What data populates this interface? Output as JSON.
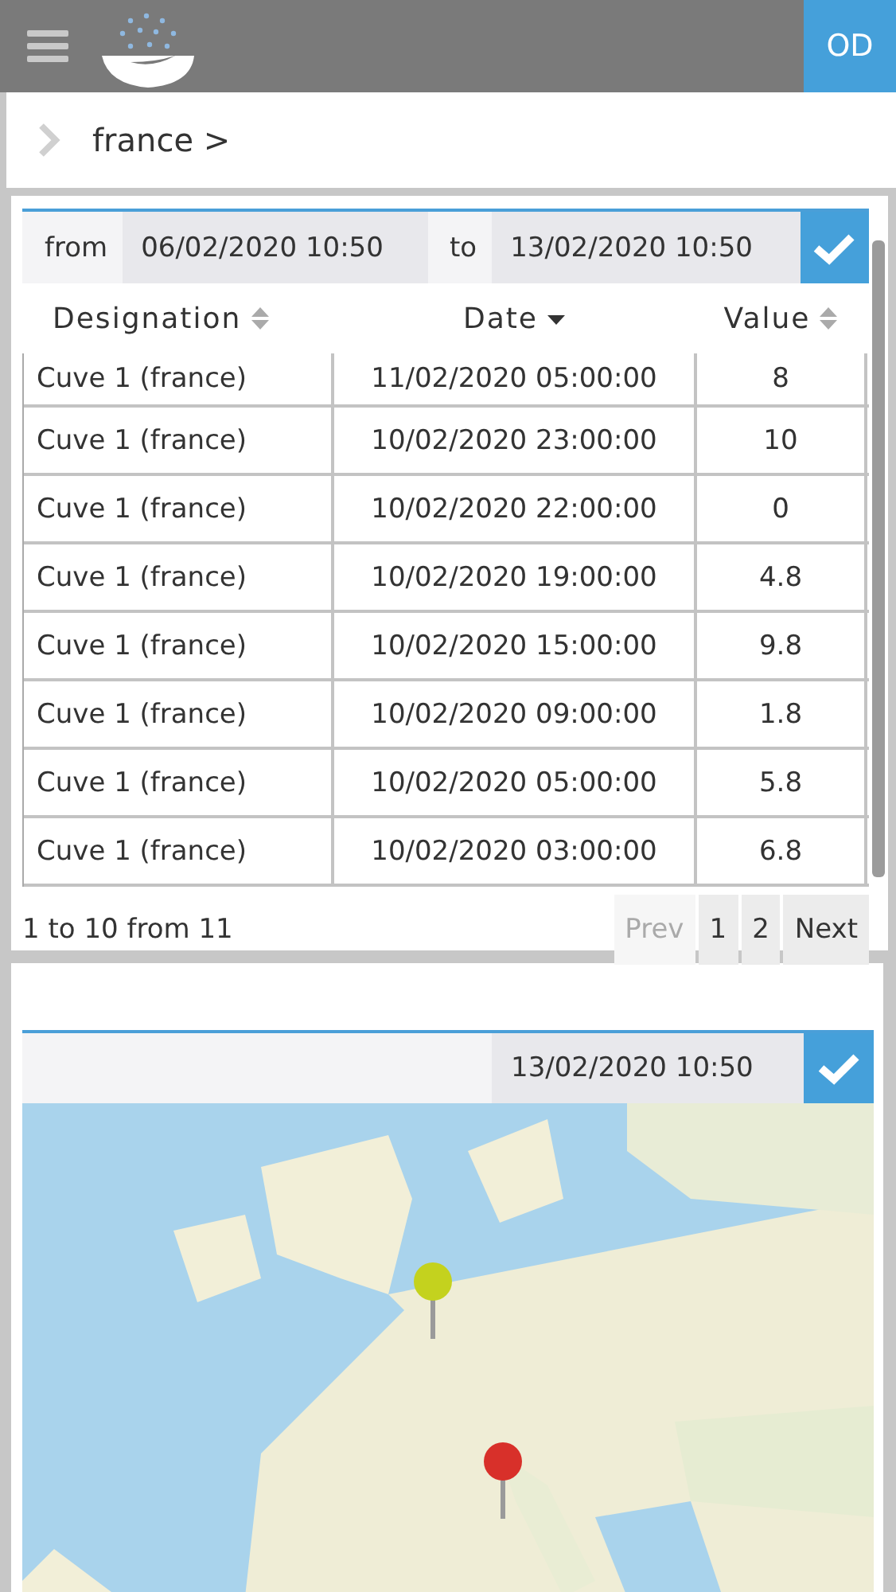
{
  "header": {
    "user_initials": "OD"
  },
  "breadcrumb": {
    "label": "france >"
  },
  "filter": {
    "from_label": "from",
    "from_value": "06/02/2020 10:50",
    "to_label": "to",
    "to_value": "13/02/2020 10:50"
  },
  "table": {
    "columns": [
      {
        "label": "Designation",
        "sorted": false
      },
      {
        "label": "Date",
        "sorted": true
      },
      {
        "label": "Value",
        "sorted": false
      }
    ],
    "rows": [
      [
        "Cuve 1 (france)",
        "11/02/2020 05:00:00",
        "8"
      ],
      [
        "Cuve 1 (france)",
        "10/02/2020 23:00:00",
        "10"
      ],
      [
        "Cuve 1 (france)",
        "10/02/2020 22:00:00",
        "0"
      ],
      [
        "Cuve 1 (france)",
        "10/02/2020 19:00:00",
        "4.8"
      ],
      [
        "Cuve 1 (france)",
        "10/02/2020 15:00:00",
        "9.8"
      ],
      [
        "Cuve 1 (france)",
        "10/02/2020 09:00:00",
        "1.8"
      ],
      [
        "Cuve 1 (france)",
        "10/02/2020 05:00:00",
        "5.8"
      ],
      [
        "Cuve 1 (france)",
        "10/02/2020 03:00:00",
        "6.8"
      ]
    ]
  },
  "pagination": {
    "summary": "1 to 10 from 11",
    "buttons": [
      {
        "label": "Prev",
        "disabled": true
      },
      {
        "label": "1",
        "disabled": false
      },
      {
        "label": "2",
        "disabled": false
      },
      {
        "label": "Next",
        "disabled": false
      }
    ]
  },
  "map_panel": {
    "date_value": "13/02/2020 10:50",
    "markers": [
      {
        "color": "#c4d21e"
      },
      {
        "color": "#d8302a"
      }
    ]
  }
}
